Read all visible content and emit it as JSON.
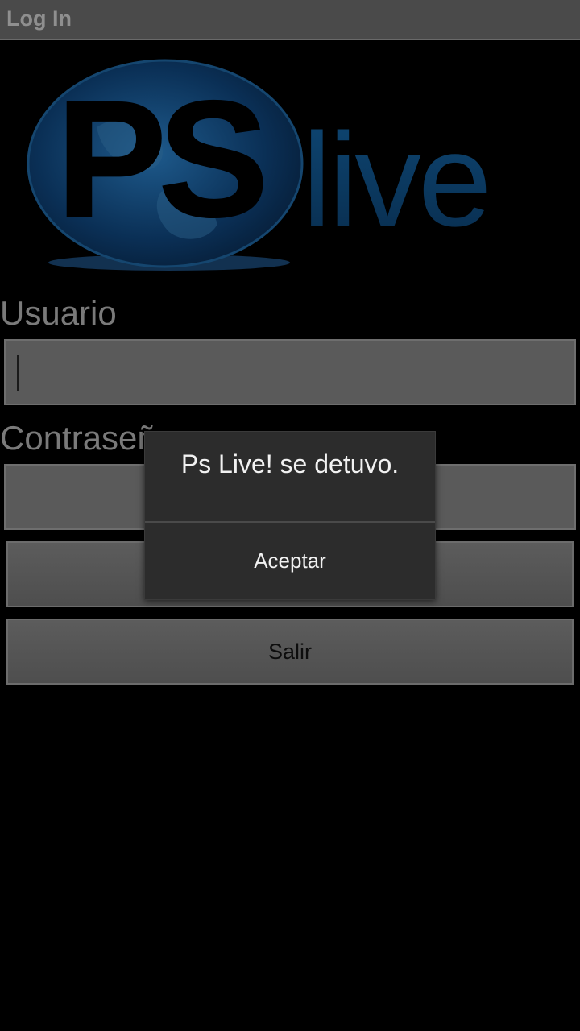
{
  "titlebar": {
    "title": "Log In"
  },
  "logo": {
    "ps": "PS",
    "live": "live"
  },
  "form": {
    "user_label": "Usuario",
    "user_value": "",
    "password_label": "Contraseña",
    "password_value": "",
    "login_button": "",
    "exit_button": "Salir"
  },
  "dialog": {
    "message": "Ps Live! se detuvo.",
    "ok_button": "Aceptar"
  },
  "colors": {
    "background": "#000000",
    "titlebar": "#4a4a4a",
    "field": "#5a5a5a",
    "dialog": "#2c2c2c",
    "logo_blue": "#0a3a66"
  }
}
